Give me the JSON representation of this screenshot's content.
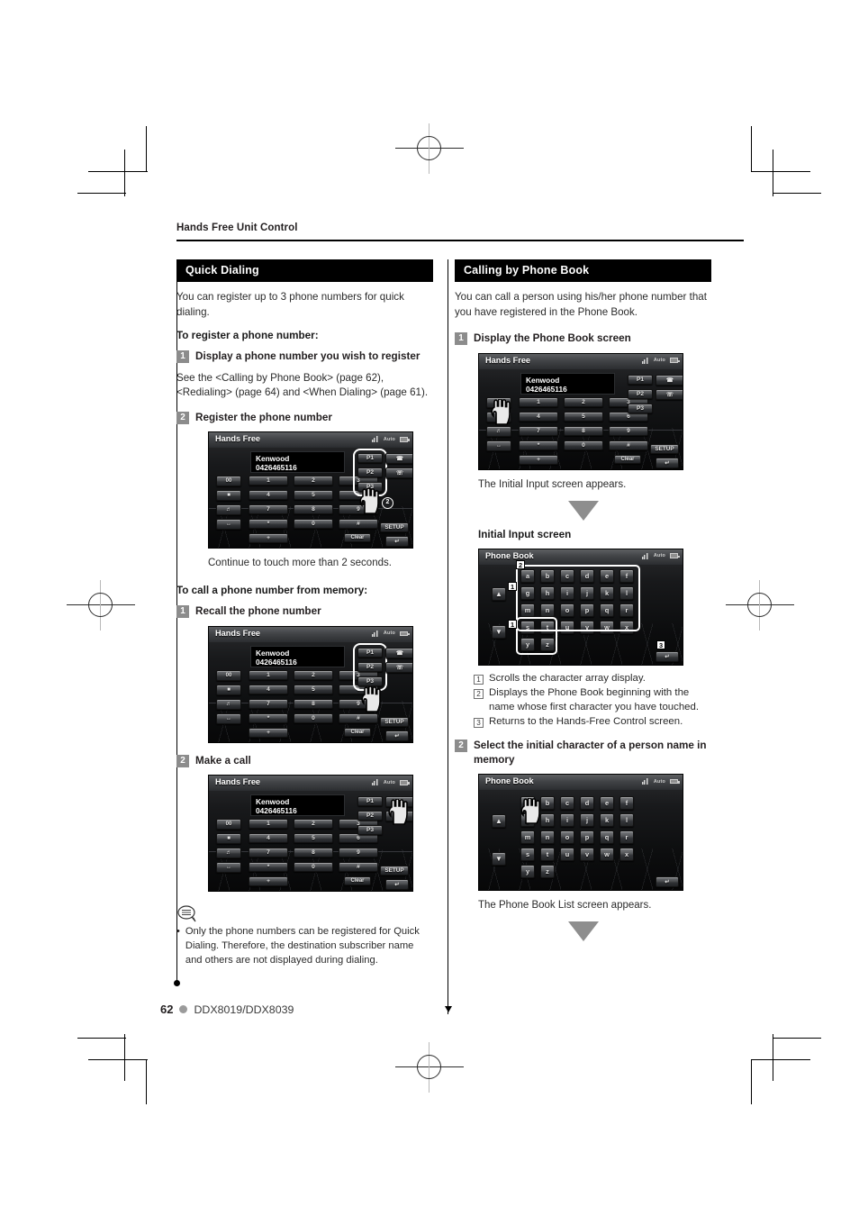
{
  "page": {
    "running_head": "Hands Free Unit Control",
    "page_number": "62",
    "model": "DDX8019/DDX8039"
  },
  "left_column": {
    "section_title": "Quick Dialing",
    "intro": "You can register up to 3 phone numbers for quick dialing.",
    "sub_heading_1": "To register a phone number:",
    "step1": {
      "num": "1",
      "text": "Display a phone number you wish to register"
    },
    "step1_body": "See the <Calling by Phone Book> (page 62), <Redialing> (page 64) and <When Dialing> (page 61).",
    "step2": {
      "num": "2",
      "text": "Register the phone number"
    },
    "caption_after_step2": "Continue to touch more than 2 seconds.",
    "sub_heading_2": "To call a phone number from memory:",
    "step3": {
      "num": "1",
      "text": "Recall the phone number"
    },
    "step4": {
      "num": "2",
      "text": "Make a call"
    },
    "note": {
      "bullet_char": "•",
      "text": "Only the phone numbers can be registered for Quick Dialing. Therefore, the destination subscriber name and others are not displayed during dialing."
    }
  },
  "right_column": {
    "section_title": "Calling by Phone Book",
    "intro": "You can call a person using his/her phone number that you have registered in the Phone Book.",
    "step1": {
      "num": "1",
      "text": "Display the Phone Book screen"
    },
    "caption1": "The Initial Input screen appears.",
    "initial_input_label": "Initial Input screen",
    "legend": [
      {
        "num": "1",
        "text": "Scrolls the character array display."
      },
      {
        "num": "2",
        "text": "Displays the Phone Book beginning with the name whose first character you have touched."
      },
      {
        "num": "3",
        "text": "Returns to the Hands-Free Control screen."
      }
    ],
    "step2": {
      "num": "2",
      "text": "Select the initial character of a person name in memory"
    },
    "caption2": "The Phone Book List screen appears."
  },
  "handsfree_screen": {
    "title": "Hands Free",
    "lcd_line1": "Kenwood",
    "lcd_line2": "0426465116",
    "status": {
      "signal": "signal-icon",
      "mode": "Auto",
      "battery": "battery-icon"
    },
    "side_keys": [
      "00-key",
      "delete-key",
      "mute-key",
      "transfer-key"
    ],
    "side_key_labels": [
      "00",
      "",
      "",
      ""
    ],
    "numeric_keys": [
      "1",
      "2",
      "3",
      "4",
      "5",
      "6",
      "7",
      "8",
      "9",
      "*",
      "0",
      "#",
      "+"
    ],
    "clear_label": "Clear",
    "preset_keys": [
      "P1",
      "P2",
      "P3"
    ],
    "call_keys": [
      "call-answer-icon",
      "call-end-icon"
    ],
    "setup_label": "SETUP",
    "return_label": "return-icon",
    "hold_seconds_badge": "2"
  },
  "phonebook_screen": {
    "title": "Phone Book",
    "status": {
      "signal": "signal-icon",
      "mode": "Auto",
      "battery": "battery-icon"
    },
    "alphabet": [
      "a",
      "b",
      "c",
      "d",
      "e",
      "f",
      "g",
      "h",
      "i",
      "j",
      "k",
      "l",
      "m",
      "n",
      "o",
      "p",
      "q",
      "r",
      "s",
      "t",
      "u",
      "v",
      "w",
      "x",
      "y",
      "z"
    ],
    "scroll_up": "▲",
    "scroll_down": "▼",
    "return_label": "return-icon",
    "callouts": {
      "scroll": "1",
      "grid": "2",
      "return": "3"
    }
  }
}
